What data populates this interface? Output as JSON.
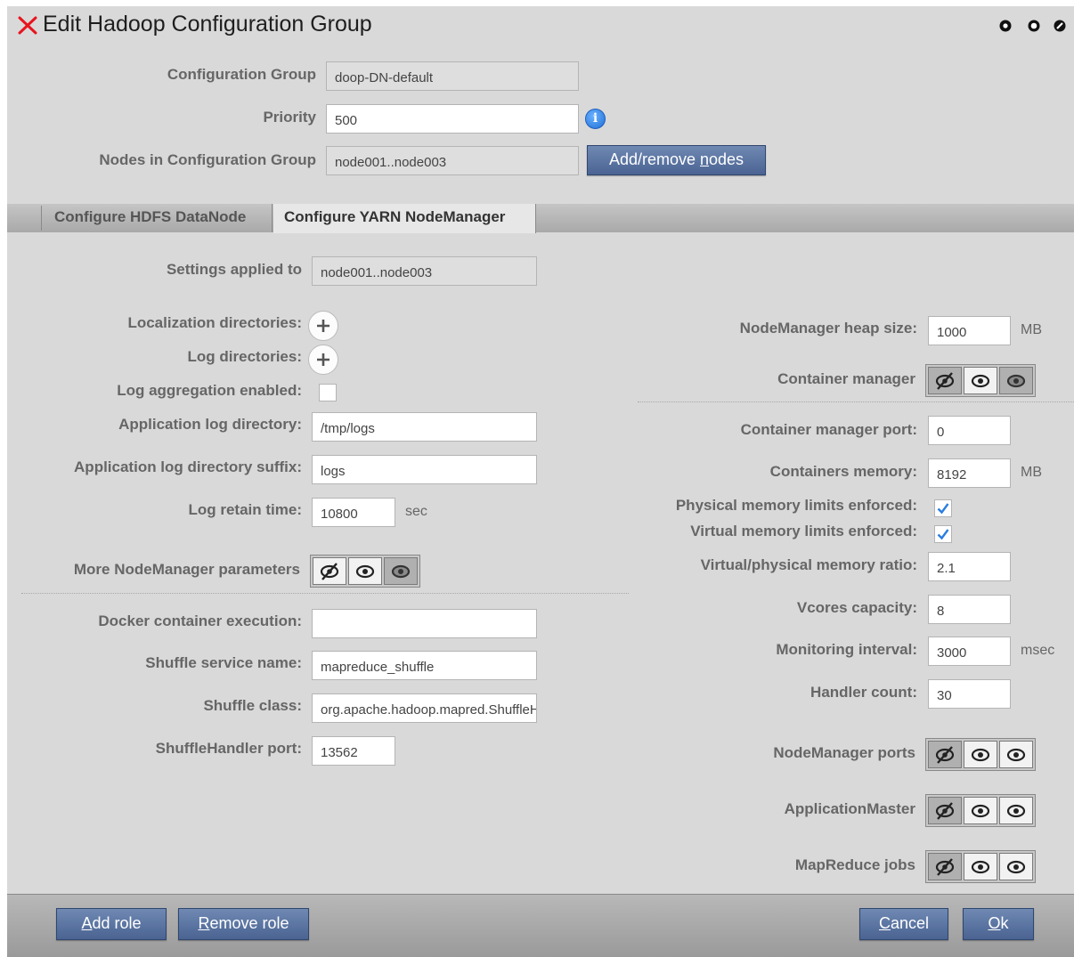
{
  "window": {
    "title": "Edit Hadoop Configuration Group"
  },
  "group": {
    "config_group_label": "Configuration Group",
    "config_group_value": "doop-DN-default",
    "priority_label": "Priority",
    "priority_value": "500",
    "nodes_label": "Nodes in Configuration Group",
    "nodes_value": "node001..node003",
    "add_remove_prefix": "Add/remove ",
    "add_remove_accel": "n",
    "add_remove_suffix": "odes"
  },
  "tabs": [
    {
      "label": "Configure HDFS DataNode",
      "active": false
    },
    {
      "label": "Configure YARN NodeManager",
      "active": true
    }
  ],
  "left": {
    "settings_applied_label": "Settings applied to",
    "settings_applied_value": "node001..node003",
    "localization_dirs_label": "Localization directories:",
    "log_dirs_label": "Log directories:",
    "log_aggregation_label": "Log aggregation enabled:",
    "log_aggregation_checked": false,
    "app_log_dir_label": "Application log directory:",
    "app_log_dir_value": "/tmp/logs",
    "app_log_suffix_label": "Application log directory suffix:",
    "app_log_suffix_value": "logs",
    "log_retain_label": "Log retain time:",
    "log_retain_value": "10800",
    "log_retain_unit": "sec",
    "more_params_label": "More NodeManager parameters",
    "docker_label": "Docker container execution:",
    "docker_value": "",
    "shuffle_service_label": "Shuffle service name:",
    "shuffle_service_value": "mapreduce_shuffle",
    "shuffle_class_label": "Shuffle class:",
    "shuffle_class_value": "org.apache.hadoop.mapred.ShuffleHandler",
    "shuffle_port_label": "ShuffleHandler port:",
    "shuffle_port_value": "13562"
  },
  "right": {
    "heap_label": "NodeManager heap size:",
    "heap_value": "1000",
    "heap_unit": "MB",
    "container_manager_label": "Container manager",
    "container_port_label": "Container manager port:",
    "container_port_value": "0",
    "containers_memory_label": "Containers memory:",
    "containers_memory_value": "8192",
    "containers_memory_unit": "MB",
    "physical_limits_label": "Physical memory limits enforced:",
    "physical_limits_checked": true,
    "virtual_limits_label": "Virtual memory limits enforced:",
    "virtual_limits_checked": true,
    "vp_ratio_label": "Virtual/physical memory ratio:",
    "vp_ratio_value": "2.1",
    "vcores_label": "Vcores capacity:",
    "vcores_value": "8",
    "monitoring_label": "Monitoring interval:",
    "monitoring_value": "3000",
    "monitoring_unit": "msec",
    "handler_label": "Handler count:",
    "handler_value": "30",
    "nm_ports_label": "NodeManager ports",
    "app_master_label": "ApplicationMaster",
    "mr_jobs_label": "MapReduce jobs"
  },
  "footer": {
    "add_role_accel": "A",
    "add_role_rest": "dd role",
    "remove_role_accel": "R",
    "remove_role_rest": "emove role",
    "cancel_accel": "C",
    "cancel_rest": "ancel",
    "ok_accel": "O",
    "ok_rest": "k"
  },
  "colors": {
    "window_bg": "#d9d9d9",
    "button_blue": "#4a6392",
    "close_x": "#e8141e",
    "info_blue": "#1f6fd6",
    "check_blue": "#2a7de1"
  },
  "icons": {
    "close": "close-x-icon",
    "window_controls": [
      "minimize-icon",
      "maximize-icon",
      "restore-icon"
    ],
    "info": "info-icon",
    "plus": "plus-icon",
    "visibility": [
      "eye-hidden-icon",
      "eye-icon",
      "eye-shaded-icon"
    ]
  }
}
